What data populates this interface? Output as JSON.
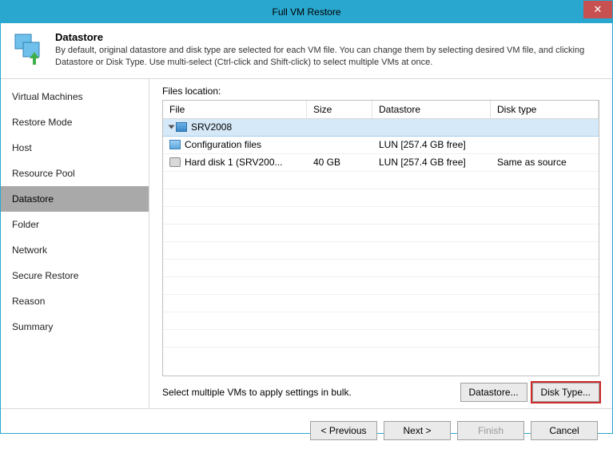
{
  "window": {
    "title": "Full VM Restore",
    "close_glyph": "✕"
  },
  "header": {
    "title": "Datastore",
    "description": "By default, original datastore and disk type are selected for each VM file. You can change them by selecting desired VM file, and clicking Datastore or Disk Type. Use multi-select (Ctrl-click and Shift-click) to select multiple VMs at once."
  },
  "sidebar": {
    "items": [
      {
        "label": "Virtual Machines"
      },
      {
        "label": "Restore Mode"
      },
      {
        "label": "Host"
      },
      {
        "label": "Resource Pool"
      },
      {
        "label": "Datastore"
      },
      {
        "label": "Folder"
      },
      {
        "label": "Network"
      },
      {
        "label": "Secure Restore"
      },
      {
        "label": "Reason"
      },
      {
        "label": "Summary"
      }
    ],
    "active_index": 4
  },
  "files": {
    "label": "Files location:",
    "columns": {
      "file": "File",
      "size": "Size",
      "datastore": "Datastore",
      "disk_type": "Disk type"
    },
    "rows": [
      {
        "file": "SRV2008",
        "size": "",
        "datastore": "",
        "disk_type": "",
        "level": 1,
        "icon": "vm",
        "selected": true
      },
      {
        "file": "Configuration files",
        "size": "",
        "datastore": "LUN [257.4 GB free]",
        "disk_type": "",
        "level": 2,
        "icon": "cfg"
      },
      {
        "file": "Hard disk 1 (SRV200...",
        "size": "40 GB",
        "datastore": "LUN [257.4 GB free]",
        "disk_type": "Same as source",
        "level": 2,
        "icon": "disk"
      }
    ]
  },
  "bulk": {
    "hint": "Select multiple VMs to apply settings in bulk.",
    "datastore_btn": "Datastore...",
    "disktype_btn": "Disk Type..."
  },
  "footer": {
    "previous": "< Previous",
    "next": "Next >",
    "finish": "Finish",
    "cancel": "Cancel"
  }
}
